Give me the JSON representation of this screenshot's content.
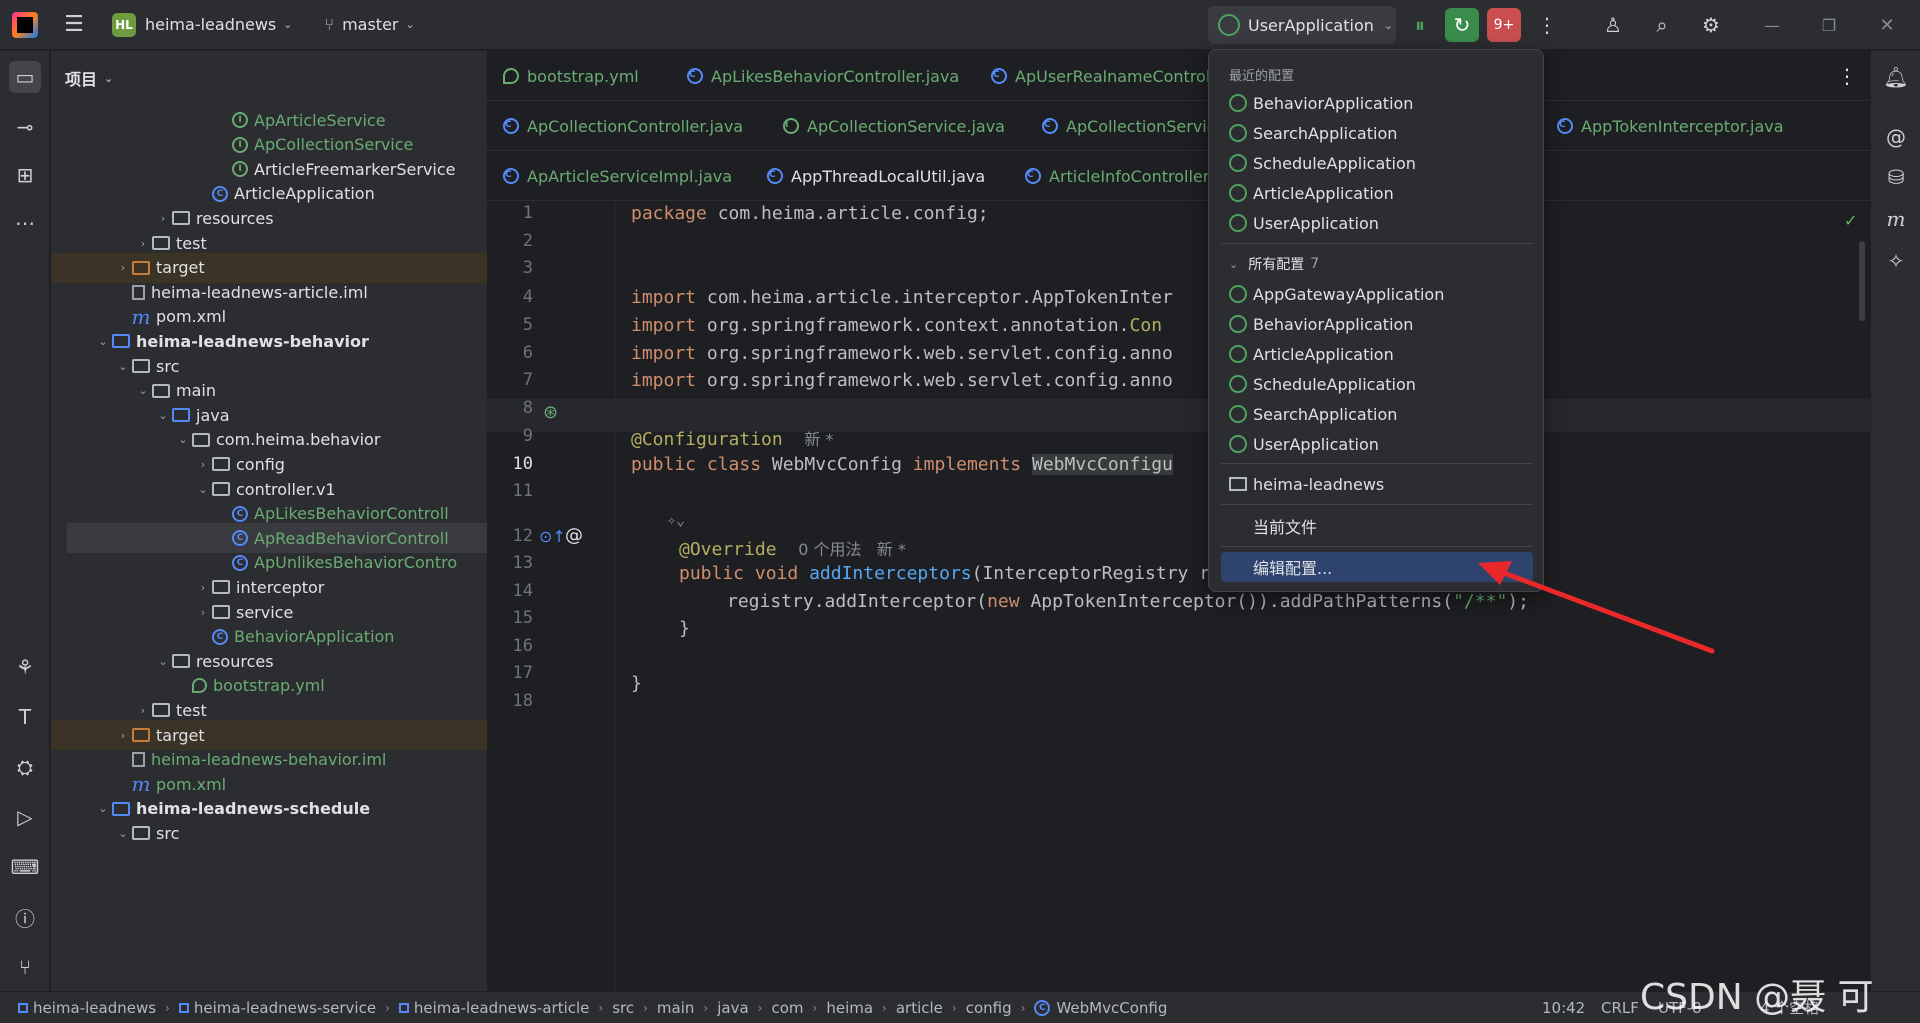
{
  "titlebar": {
    "project_badge": "HL",
    "project_name": "heima-leadnews",
    "branch": "master",
    "run_config": "UserApplication",
    "update_badge": "9+"
  },
  "project_panel": {
    "title": "项目",
    "rows": [
      {
        "label": "ApArticleService",
        "icon": "interface-icon",
        "indent": 232,
        "color": "green"
      },
      {
        "label": "ApCollectionService",
        "icon": "interface-icon",
        "indent": 232,
        "color": "green"
      },
      {
        "label": "ArticleFreemarkerService",
        "icon": "interface-icon",
        "indent": 232,
        "color": "normal"
      },
      {
        "label": "ArticleApplication",
        "icon": "class-icon",
        "indent": 212,
        "color": "normal"
      },
      {
        "label": "resources",
        "icon": "folder-icon",
        "indent": 172,
        "arrow": "›",
        "color": "normal"
      },
      {
        "label": "test",
        "icon": "folder-icon",
        "indent": 152,
        "arrow": "›",
        "color": "normal"
      },
      {
        "label": "target",
        "icon": "folder-orange-icon",
        "indent": 132,
        "arrow": "›",
        "color": "normal",
        "hl": true
      },
      {
        "label": "heima-leadnews-article.iml",
        "icon": "file-icon",
        "indent": 132,
        "color": "normal"
      },
      {
        "label": "pom.xml",
        "icon": "maven-icon",
        "indent": 132,
        "color": "normal"
      },
      {
        "label": "heima-leadnews-behavior",
        "icon": "module-folder-icon",
        "indent": 112,
        "arrow": "⌄",
        "color": "bold"
      },
      {
        "label": "src",
        "icon": "folder-icon",
        "indent": 132,
        "arrow": "⌄",
        "color": "normal"
      },
      {
        "label": "main",
        "icon": "folder-icon",
        "indent": 152,
        "arrow": "⌄",
        "color": "normal"
      },
      {
        "label": "java",
        "icon": "folder-blue-icon",
        "indent": 172,
        "arrow": "⌄",
        "color": "normal"
      },
      {
        "label": "com.heima.behavior",
        "icon": "package-icon",
        "indent": 192,
        "arrow": "⌄",
        "color": "normal"
      },
      {
        "label": "config",
        "icon": "package-icon",
        "indent": 212,
        "arrow": "›",
        "color": "normal"
      },
      {
        "label": "controller.v1",
        "icon": "package-icon",
        "indent": 212,
        "arrow": "⌄",
        "color": "normal"
      },
      {
        "label": "ApLikesBehaviorControll",
        "icon": "class-icon",
        "indent": 232,
        "color": "green"
      },
      {
        "label": "ApReadBehaviorControll",
        "icon": "class-icon",
        "indent": 232,
        "color": "green",
        "selected": true
      },
      {
        "label": "ApUnlikesBehaviorContro",
        "icon": "class-icon",
        "indent": 232,
        "color": "green"
      },
      {
        "label": "interceptor",
        "icon": "package-icon",
        "indent": 212,
        "arrow": "›",
        "color": "normal"
      },
      {
        "label": "service",
        "icon": "package-icon",
        "indent": 212,
        "arrow": "›",
        "color": "normal"
      },
      {
        "label": "BehaviorApplication",
        "icon": "class-icon",
        "indent": 212,
        "color": "green"
      },
      {
        "label": "resources",
        "icon": "folder-icon",
        "indent": 172,
        "arrow": "⌄",
        "color": "normal"
      },
      {
        "label": "bootstrap.yml",
        "icon": "yml-icon",
        "indent": 192,
        "color": "green"
      },
      {
        "label": "test",
        "icon": "folder-icon",
        "indent": 152,
        "arrow": "›",
        "color": "normal"
      },
      {
        "label": "target",
        "icon": "folder-orange-icon",
        "indent": 132,
        "arrow": "›",
        "color": "normal",
        "hl": true
      },
      {
        "label": "heima-leadnews-behavior.iml",
        "icon": "file-icon",
        "indent": 132,
        "color": "green"
      },
      {
        "label": "pom.xml",
        "icon": "maven-icon",
        "indent": 132,
        "color": "green"
      },
      {
        "label": "heima-leadnews-schedule",
        "icon": "module-folder-icon",
        "indent": 112,
        "arrow": "⌄",
        "color": "bold"
      },
      {
        "label": "src",
        "icon": "folder-icon",
        "indent": 132,
        "arrow": "⌄",
        "color": "normal"
      }
    ]
  },
  "editor": {
    "tabs_row1": [
      {
        "label": "bootstrap.yml",
        "icon": "yml-icon"
      },
      {
        "label": "ApLikesBehaviorController.java",
        "icon": "class-icon"
      },
      {
        "label": "ApUserRealnameControlle",
        "icon": "class-icon"
      }
    ],
    "tabs_row2": [
      {
        "label": "ApCollectionController.java",
        "icon": "class-icon"
      },
      {
        "label": "ApCollectionService.java",
        "icon": "interface-icon"
      },
      {
        "label": "ApCollectionServic",
        "icon": "class-icon"
      },
      {
        "label": "AppTokenInterceptor.java",
        "icon": "class-icon"
      }
    ],
    "tabs_row3": [
      {
        "label": "ApArticleServiceImpl.java",
        "icon": "class-icon"
      },
      {
        "label": "AppThreadLocalUtil.java",
        "icon": "class-icon"
      },
      {
        "label": "ArticleInfoController.j",
        "icon": "class-icon"
      }
    ],
    "line_numbers": [
      "1",
      "2",
      "3",
      "4",
      "5",
      "6",
      "7",
      "8",
      "9",
      "10",
      "11",
      "12",
      "13",
      "14",
      "15",
      "16",
      "17",
      "18"
    ],
    "code": {
      "l1_kw": "package",
      "l1_rest": " com.heima.article.config;",
      "l4_kw": "import",
      "l4_rest": " com.heima.article.interceptor.AppTokenInter",
      "l5_kw": "import",
      "l5_rest": " org.springframework.context.annotation.",
      "l5_tail": "Con",
      "l6_kw": "import",
      "l6_rest": " org.springframework.web.servlet.config.anno",
      "l7_kw": "import",
      "l7_rest": " org.springframework.web.servlet.config.anno",
      "l9_ann": "@Configuration",
      "l9_hint": "新 *",
      "l10_kw1": "public class",
      "l10_name": " WebMvcConfig ",
      "l10_kw2": "implements",
      "l10_iface": "WebMvcConfigu",
      "l12_ann": "@Override",
      "l12_hint": "0 个用法   新 *",
      "l13_kw": "public void",
      "l13_fn": "addInterceptors",
      "l13_rest": "(InterceptorRegistry registry) {",
      "l14_a": "registry.addInterceptor(",
      "l14_kw": "new",
      "l14_b": " AppTokenInterceptor()).addPathPatterns(",
      "l14_str": "\"/**\"",
      "l14_c": ");",
      "l15": "}",
      "l17": "}"
    }
  },
  "dropdown": {
    "recent_title": "最近的配置",
    "recent": [
      "BehaviorApplication",
      "SearchApplication",
      "ScheduleApplication",
      "ArticleApplication",
      "UserApplication"
    ],
    "all_title": "所有配置",
    "all_count": "7",
    "all": [
      "AppGatewayApplication",
      "BehaviorApplication",
      "ArticleApplication",
      "ScheduleApplication",
      "SearchApplication",
      "UserApplication"
    ],
    "project_item": "heima-leadnews",
    "current_file": "当前文件",
    "edit_configs": "编辑配置..."
  },
  "statusbar": {
    "breadcrumbs": [
      "heima-leadnews",
      "heima-leadnews-service",
      "heima-leadnews-article",
      "src",
      "main",
      "java",
      "com",
      "heima",
      "article",
      "config",
      "WebMvcConfig"
    ],
    "position": "10:42",
    "line_sep": "CRLF",
    "encoding": "UTF-8",
    "indent": "4 个空格"
  },
  "watermark": "CSDN @聂 可 以",
  "colors": {
    "accent": "#548af7",
    "green_vcs": "#6aab73",
    "keyword": "#cf8e6d",
    "annotation": "#b3ae60",
    "selection": "#2e436e",
    "arrow": "#e8282b"
  }
}
